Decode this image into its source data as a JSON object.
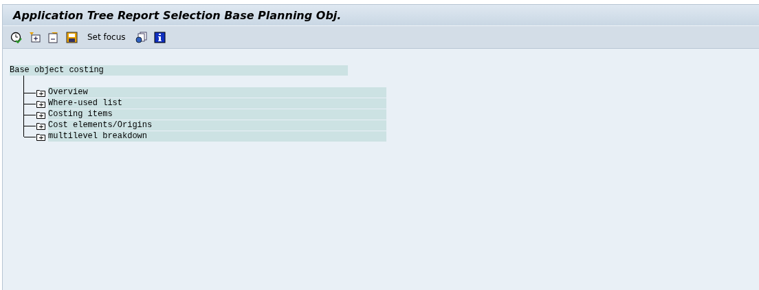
{
  "window": {
    "title": "Application Tree Report Selection Base Planning Obj."
  },
  "toolbar": [
    {
      "kind": "execute"
    },
    {
      "kind": "expand"
    },
    {
      "kind": "collapse"
    },
    {
      "kind": "save"
    },
    {
      "kind": "text",
      "label": "Set focus"
    },
    {
      "kind": "pages"
    },
    {
      "kind": "info"
    }
  ],
  "tree": {
    "label": "Base object costing",
    "children": [
      {
        "label": "Overview",
        "expanded": false
      },
      {
        "label": "Where-used list",
        "expanded": false
      },
      {
        "label": "Costing items",
        "expanded": false
      },
      {
        "label": "Cost elements/Origins",
        "expanded": false
      },
      {
        "label": "multilevel breakdown",
        "expanded": false
      }
    ]
  }
}
